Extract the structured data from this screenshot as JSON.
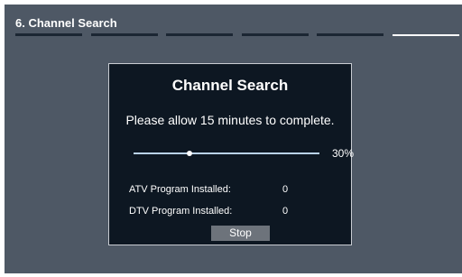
{
  "header": {
    "step_title": "6. Channel Search",
    "steps_total": 6,
    "active_step": 6
  },
  "dialog": {
    "title": "Channel Search",
    "message": "Please allow 15 minutes to complete.",
    "progress": {
      "percent": 30,
      "label": "30%"
    },
    "atv": {
      "label": "ATV Program Installed:",
      "value": "0"
    },
    "dtv": {
      "label": "DTV Program Installed:",
      "value": "0"
    },
    "stop_label": "Stop"
  },
  "colors": {
    "screen_background": "#4e5865",
    "dialog_background": "#0d1722",
    "dialog_border": "#c8ccd2",
    "step_inactive": "#1b2633",
    "step_active": "#ffffff",
    "progress_track": "#b9d2ea",
    "button_background": "#6d737b",
    "text": "#ffffff"
  }
}
